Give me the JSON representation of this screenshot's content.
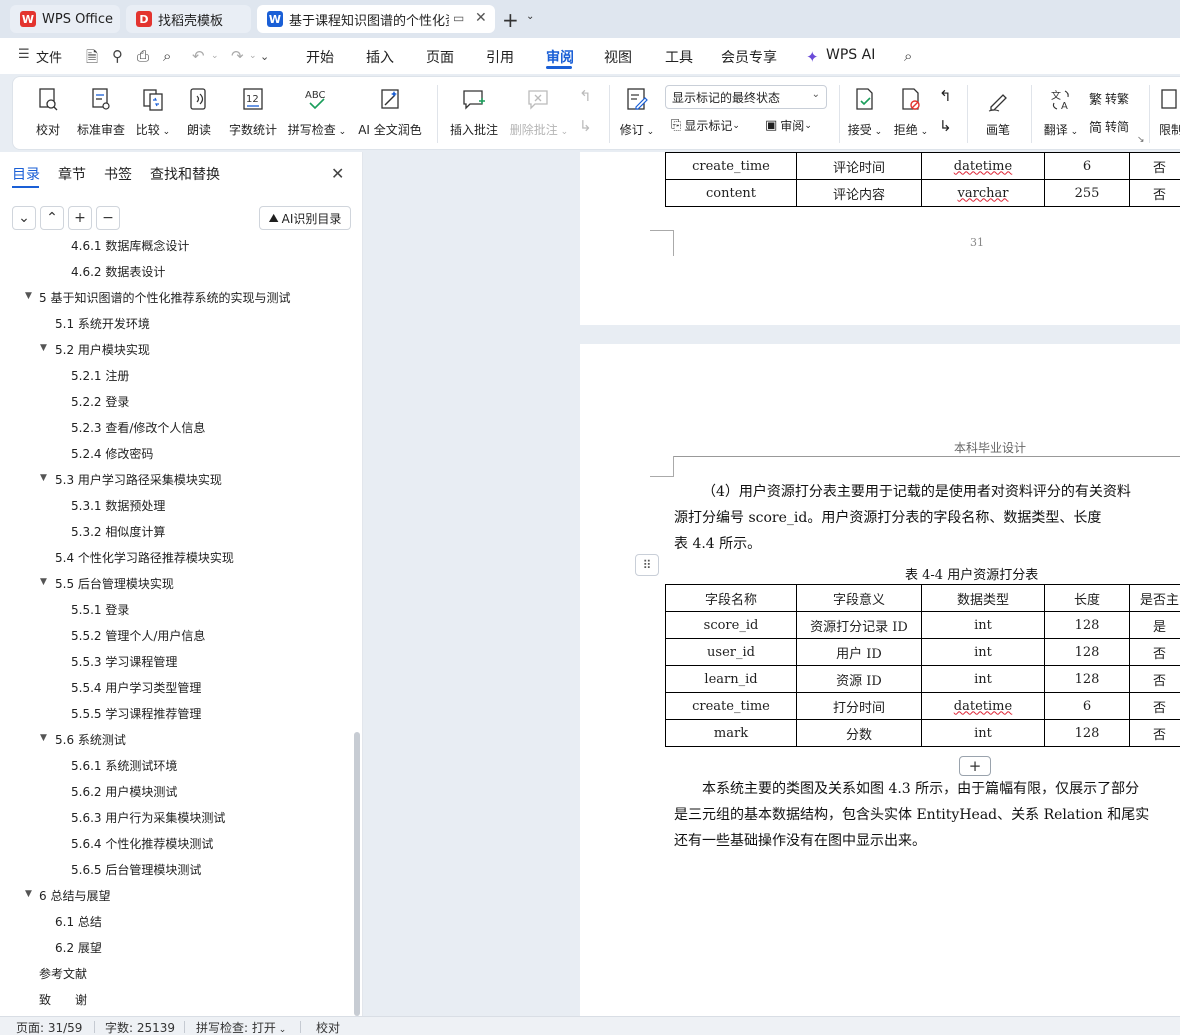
{
  "tabs": [
    {
      "label": "WPS Office",
      "logo": "W",
      "color": "#e3342f"
    },
    {
      "label": "找稻壳模板",
      "logo": "D",
      "color": "#e3342f"
    },
    {
      "label": "基于课程知识图谱的个性化资",
      "logo": "W",
      "color": "#1a5fd6"
    }
  ],
  "menu": {
    "file": "文件",
    "items": [
      "开始",
      "插入",
      "页面",
      "引用",
      "审阅",
      "视图",
      "工具",
      "会员专享"
    ],
    "active": "审阅",
    "wps_ai": "WPS AI"
  },
  "ribbon": {
    "proofread": "校对",
    "standard_review": "标准审查",
    "compare": "比较",
    "read_aloud": "朗读",
    "word_count": "字数统计",
    "spell_check": "拼写检查",
    "ai_polish": "AI 全文润色",
    "insert_comment": "插入批注",
    "delete_comment": "删除批注",
    "track_changes": "修订",
    "markup_select": "显示标记的最终状态",
    "show_markup": "显示标记",
    "review_pane": "审阅",
    "accept": "接受",
    "reject": "拒绝",
    "pen": "画笔",
    "translate": "翻译",
    "to_traditional": "转繁",
    "to_simplified": "转简",
    "restrict": "限制"
  },
  "nav": {
    "tabs": [
      "目录",
      "章节",
      "书签",
      "查找和替换"
    ],
    "ai_toc": "AI识别目录",
    "toc": [
      {
        "text": "4.6.1  数据库概念设计",
        "level": 3,
        "arrow": false
      },
      {
        "text": "4.6.2  数据表设计",
        "level": 3,
        "arrow": false
      },
      {
        "text": "5  基于知识图谱的个性化推荐系统的实现与测试",
        "level": 1,
        "arrow": true
      },
      {
        "text": "5.1  系统开发环境",
        "level": 2,
        "arrow": false
      },
      {
        "text": "5.2  用户模块实现",
        "level": 2,
        "arrow": true
      },
      {
        "text": "5.2.1  注册",
        "level": 3,
        "arrow": false
      },
      {
        "text": "5.2.2  登录",
        "level": 3,
        "arrow": false
      },
      {
        "text": "5.2.3  查看/修改个人信息",
        "level": 3,
        "arrow": false
      },
      {
        "text": "5.2.4  修改密码",
        "level": 3,
        "arrow": false
      },
      {
        "text": "5.3  用户学习路径采集模块实现",
        "level": 2,
        "arrow": true
      },
      {
        "text": "5.3.1  数据预处理",
        "level": 3,
        "arrow": false
      },
      {
        "text": "5.3.2  相似度计算",
        "level": 3,
        "arrow": false
      },
      {
        "text": "5.4  个性化学习路径推荐模块实现",
        "level": 2,
        "arrow": false
      },
      {
        "text": "5.5  后台管理模块实现",
        "level": 2,
        "arrow": true
      },
      {
        "text": "5.5.1  登录",
        "level": 3,
        "arrow": false
      },
      {
        "text": "5.5.2  管理个人/用户信息",
        "level": 3,
        "arrow": false
      },
      {
        "text": "5.5.3  学习课程管理",
        "level": 3,
        "arrow": false
      },
      {
        "text": "5.5.4  用户学习类型管理",
        "level": 3,
        "arrow": false
      },
      {
        "text": "5.5.5  学习课程推荐管理",
        "level": 3,
        "arrow": false
      },
      {
        "text": "5.6 系统测试",
        "level": 2,
        "arrow": true
      },
      {
        "text": "5.6.1  系统测试环境",
        "level": 3,
        "arrow": false
      },
      {
        "text": "5.6.2  用户模块测试",
        "level": 3,
        "arrow": false
      },
      {
        "text": "5.6.3  用户行为采集模块测试",
        "level": 3,
        "arrow": false
      },
      {
        "text": "5.6.4  个性化推荐模块测试",
        "level": 3,
        "arrow": false
      },
      {
        "text": "5.6.5  后台管理模块测试",
        "level": 3,
        "arrow": false
      },
      {
        "text": "6  总结与展望",
        "level": 1,
        "arrow": true
      },
      {
        "text": "6.1  总结",
        "level": 2,
        "arrow": false
      },
      {
        "text": "6.2  展望",
        "level": 2,
        "arrow": false
      },
      {
        "text": "参考文献",
        "level": 1,
        "arrow": false
      },
      {
        "text": "致　　谢",
        "level": 1,
        "arrow": false
      }
    ]
  },
  "doc": {
    "prev_table_rows": [
      [
        "create_time",
        "评论时间",
        "datetime",
        "6",
        "否"
      ],
      [
        "content",
        "评论内容",
        "varchar",
        "255",
        "否"
      ]
    ],
    "prev_page_number": "31",
    "header_text": "本科毕业设计",
    "para1": [
      "（4）用户资源打分表主要用于记载的是使用者对资料评分的有关资料",
      "源打分编号 score_id。用户资源打分表的字段名称、数据类型、长度",
      "表 4.4 所示。"
    ],
    "table_caption": "表 4-4  用户资源打分表",
    "table_header": [
      "字段名称",
      "字段意义",
      "数据类型",
      "长度",
      "是否主"
    ],
    "table_rows": [
      [
        "score_id",
        "资源打分记录 ID",
        "int",
        "128",
        "是"
      ],
      [
        "user_id",
        "用户 ID",
        "int",
        "128",
        "否"
      ],
      [
        "learn_id",
        "资源 ID",
        "int",
        "128",
        "否"
      ],
      [
        "create_time",
        "打分时间",
        "datetime",
        "6",
        "否"
      ],
      [
        "mark",
        "分数",
        "int",
        "128",
        "否"
      ]
    ],
    "para2": [
      "本系统主要的类图及关系如图 4.3 所示，由于篇幅有限，仅展示了部分",
      "是三元组的基本数据结构，包含头实体 EntityHead、关系 Relation 和尾实",
      "还有一些基础操作没有在图中显示出来。"
    ]
  },
  "status": {
    "page": "页面: 31/59",
    "words": "字数: 25139",
    "spell": "拼写检查: 打开",
    "proof": "校对"
  }
}
